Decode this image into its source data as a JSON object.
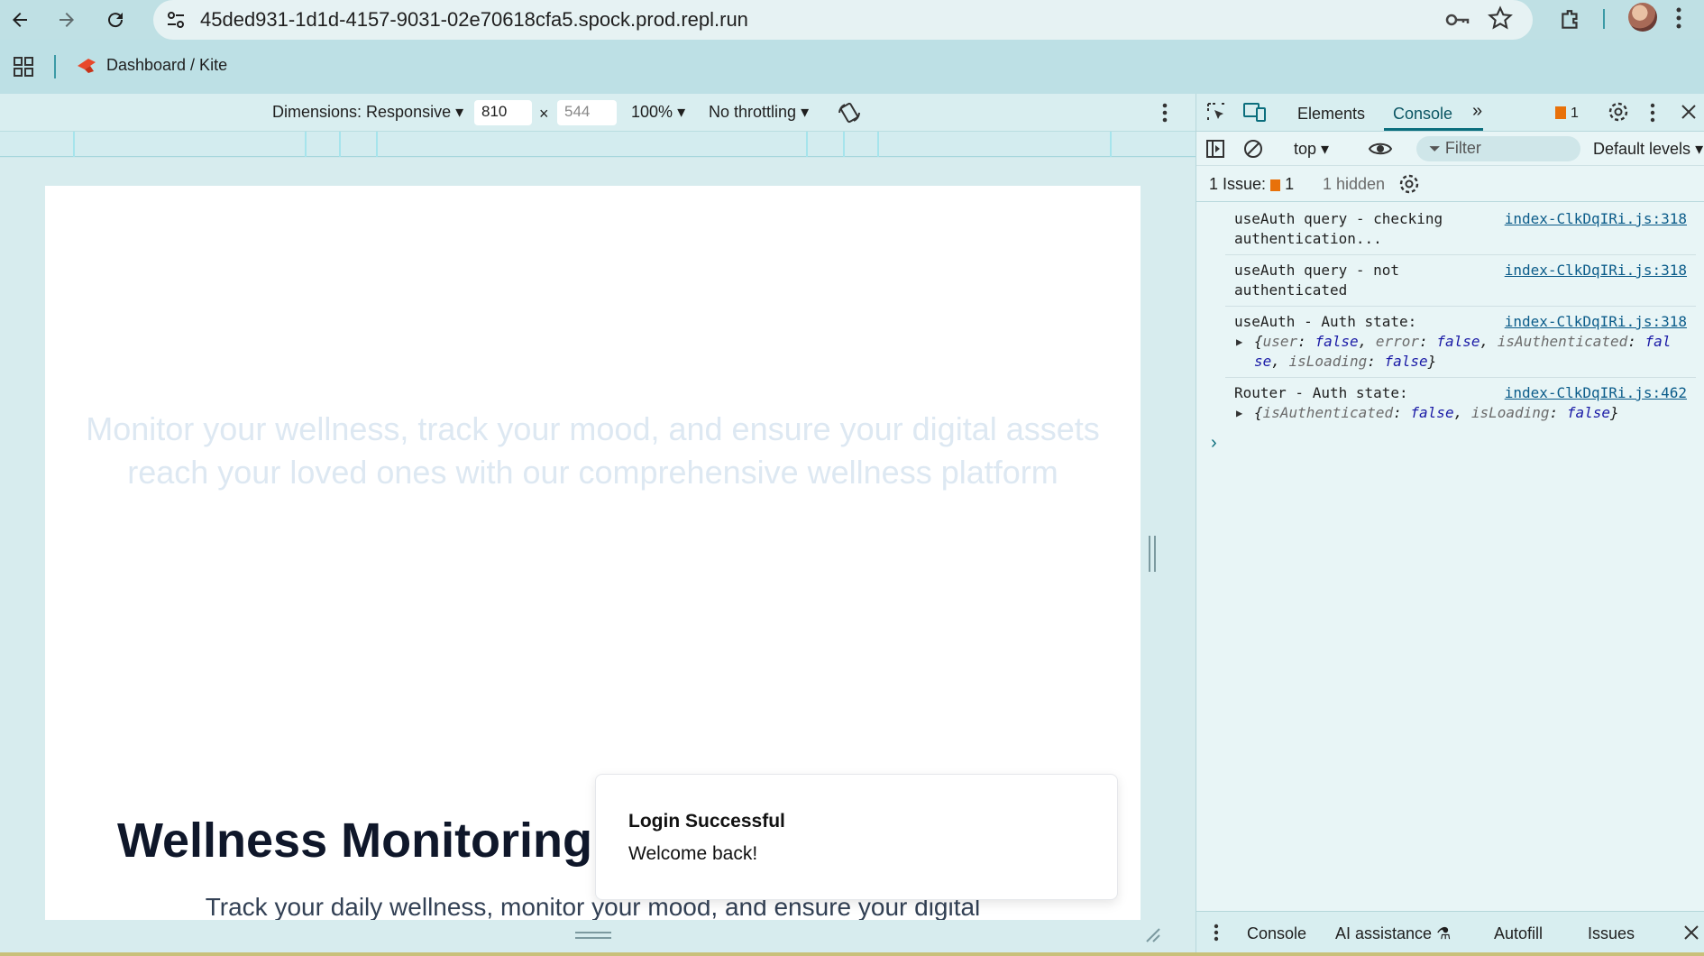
{
  "browser": {
    "url": "45ded931-1d1d-4157-9031-02e70618cfa5.spock.prod.repl.run"
  },
  "bookmarks": {
    "items": [
      {
        "label": "Dashboard / Kite"
      }
    ]
  },
  "device_toolbar": {
    "dimensions_label": "Dimensions: Responsive",
    "width": "810",
    "times": "×",
    "height": "544",
    "zoom": "100%",
    "throttling": "No throttling"
  },
  "page": {
    "hero_text_line1": "Monitor your wellness, track your mood, and ensure your digital assets",
    "hero_text_line2": "reach your loved ones with our comprehensive wellness platform",
    "heading": "Wellness Monitoring",
    "subtext": "Track your daily wellness, monitor your mood, and ensure your digital"
  },
  "toast": {
    "title": "Login Successful",
    "description": "Welcome back!"
  },
  "devtools": {
    "tabs": {
      "elements": "Elements",
      "console": "Console"
    },
    "issue_badge_count": "1",
    "context": "top",
    "filter_placeholder": "Filter",
    "levels": "Default levels",
    "issues_label": "1 Issue:",
    "issues_count": "1",
    "hidden_label": "1 hidden",
    "logs": [
      {
        "msg": "useAuth query - checking authentication...",
        "src": "index-ClkDqIRi.js:318"
      },
      {
        "msg": "useAuth query - not authenticated",
        "src": "index-ClkDqIRi.js:318"
      },
      {
        "msg": "useAuth - Auth state:",
        "src": "index-ClkDqIRi.js:318"
      },
      {
        "msg": "Router - Auth state:",
        "src": "index-ClkDqIRi.js:462"
      }
    ],
    "obj1": {
      "k1": "user",
      "v1": "false",
      "k2": "error",
      "v2": "false",
      "k3": "isAuthenticated",
      "v3a": "fal",
      "v3b": "se",
      "k4": "isLoading",
      "v4": "false"
    },
    "obj2": {
      "k1": "isAuthenticated",
      "v1": "false",
      "k2": "isLoading",
      "v2": "false"
    },
    "drawer": {
      "console": "Console",
      "ai": "AI assistance",
      "autofill": "Autofill",
      "issues": "Issues"
    }
  },
  "colors": {
    "accent": "#0b6e7d",
    "toolbar": "#bfe0e4",
    "devtools_bg": "#e8f5f6"
  }
}
